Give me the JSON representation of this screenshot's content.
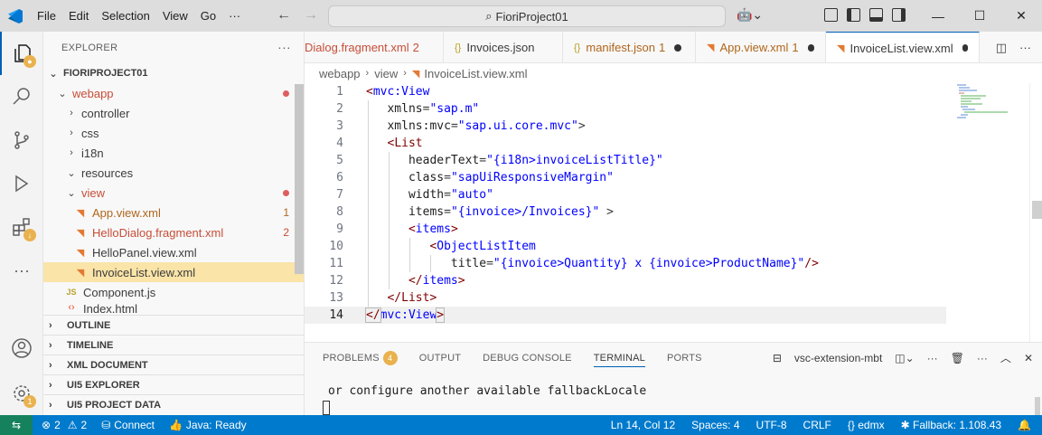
{
  "titlebar": {
    "menu": [
      "File",
      "Edit",
      "Selection",
      "View",
      "Go"
    ],
    "more": "···",
    "search_text": "FioriProject01"
  },
  "explorer": {
    "header": "EXPLORER",
    "project": "FIORIPROJECT01",
    "items": [
      {
        "label": "webapp",
        "depth": 1,
        "type": "folder-open",
        "status": "dot",
        "color": "red"
      },
      {
        "label": "controller",
        "depth": 2,
        "type": "folder"
      },
      {
        "label": "css",
        "depth": 2,
        "type": "folder"
      },
      {
        "label": "i18n",
        "depth": 2,
        "type": "folder"
      },
      {
        "label": "resources",
        "depth": 2,
        "type": "folder-open"
      },
      {
        "label": "view",
        "depth": 2,
        "type": "folder-open",
        "status": "dot",
        "color": "red"
      },
      {
        "label": "App.view.xml",
        "depth": 3,
        "type": "xml",
        "count": "1",
        "color": "orange"
      },
      {
        "label": "HelloDialog.fragment.xml",
        "depth": 3,
        "type": "xml",
        "count": "2",
        "color": "red"
      },
      {
        "label": "HelloPanel.view.xml",
        "depth": 3,
        "type": "xml"
      },
      {
        "label": "InvoiceList.view.xml",
        "depth": 3,
        "type": "xml",
        "selected": true
      },
      {
        "label": "Component.js",
        "depth": 2,
        "type": "js"
      },
      {
        "label": "Index.html",
        "depth": 2,
        "type": "html"
      }
    ],
    "sections": [
      "OUTLINE",
      "TIMELINE",
      "XML DOCUMENT",
      "UI5 EXPLORER",
      "UI5 PROJECT DATA"
    ]
  },
  "tabs": [
    {
      "label": "Dialog.fragment.xml",
      "count": "2",
      "icon": "rss-icon",
      "color": "red"
    },
    {
      "label": "Invoices.json",
      "icon": "braces-icon"
    },
    {
      "label": "manifest.json",
      "count": "1",
      "icon": "braces-icon",
      "color": "orange",
      "modified": true
    },
    {
      "label": "App.view.xml",
      "count": "1",
      "icon": "rss-icon",
      "color": "orange",
      "modified": true
    },
    {
      "label": "InvoiceList.view.xml",
      "icon": "rss-icon",
      "active": true,
      "modified": true
    }
  ],
  "breadcrumb": [
    "webapp",
    "view",
    "InvoiceList.view.xml"
  ],
  "editor": {
    "lines": [
      "1",
      "2",
      "3",
      "4",
      "5",
      "6",
      "7",
      "8",
      "9",
      "10",
      "11",
      "12",
      "13",
      "14"
    ]
  },
  "panel": {
    "tabs": [
      "PROBLEMS",
      "OUTPUT",
      "DEBUG CONSOLE",
      "TERMINAL",
      "PORTS"
    ],
    "problems_badge": "4",
    "terminal_name": "vsc-extension-mbt",
    "terminal_text": "or configure another available fallbackLocale"
  },
  "statusbar": {
    "errors": "2",
    "warnings": "2",
    "connect": "Connect",
    "java": "Java: Ready",
    "position": "Ln 14, Col 12",
    "spaces": "Spaces: 4",
    "encoding": "UTF-8",
    "eol": "CRLF",
    "language": "edmx",
    "fallback": "Fallback: 1.108.43"
  },
  "colors": {
    "accent": "#005fb8",
    "status": "#007acc",
    "remote": "#16825d",
    "badge": "#e9b24e",
    "error": "#c74e39"
  }
}
